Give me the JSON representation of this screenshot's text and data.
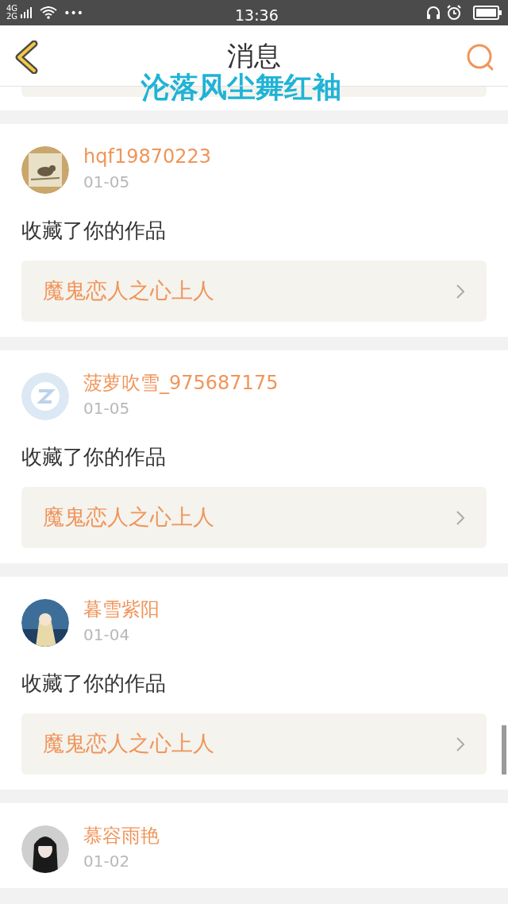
{
  "status_bar": {
    "network_top": "4G",
    "network_bottom": "2G",
    "dots": "•••",
    "time": "13:36"
  },
  "header": {
    "title": "消息"
  },
  "overlay_caption": "沦落风尘舞红袖",
  "messages": [
    {
      "user": "hqf19870223",
      "date": "01-05",
      "action": "收藏了你的作品",
      "work": "魔鬼恋人之心上人"
    },
    {
      "user": "菠萝吹雪_975687175",
      "date": "01-05",
      "action": "收藏了你的作品",
      "work": "魔鬼恋人之心上人"
    },
    {
      "user": "暮雪紫阳",
      "date": "01-04",
      "action": "收藏了你的作品",
      "work": "魔鬼恋人之心上人"
    },
    {
      "user": "慕容雨艳",
      "date": "01-02"
    }
  ]
}
